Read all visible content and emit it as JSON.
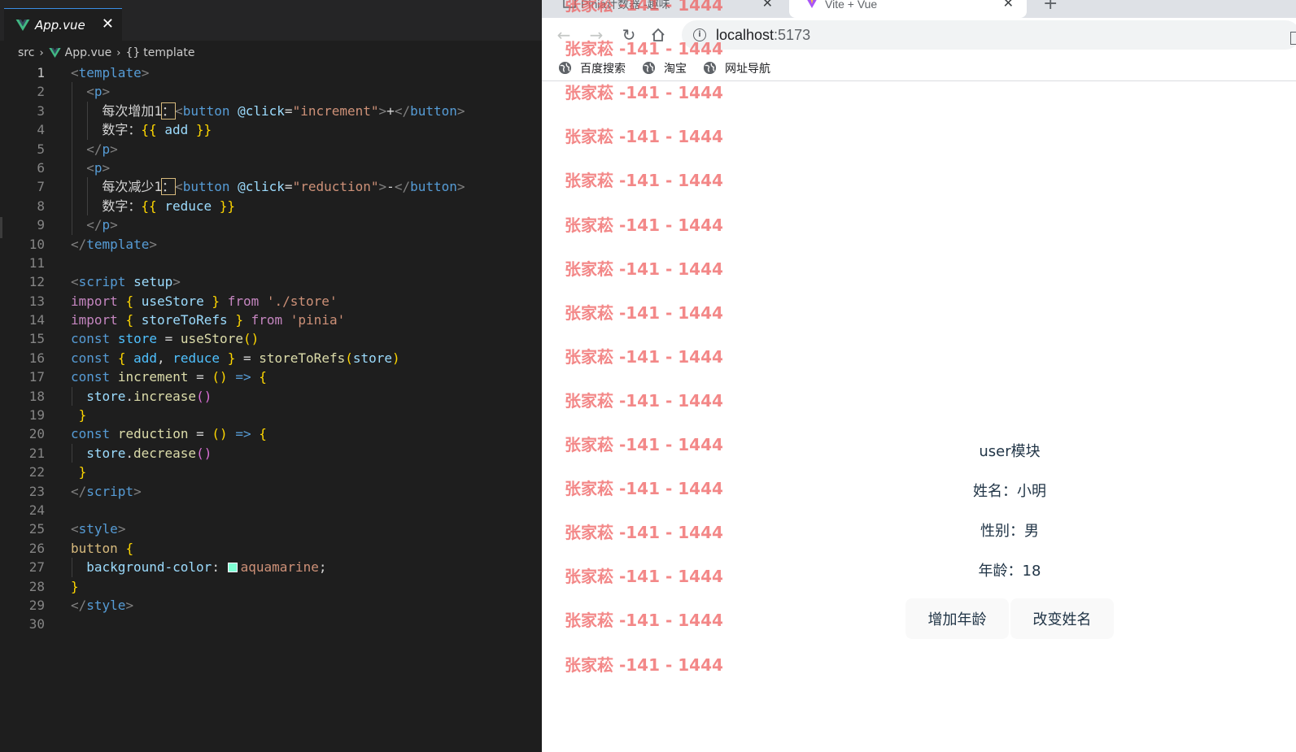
{
  "editor": {
    "tab": {
      "label": "App.vue",
      "close_glyph": "✕"
    },
    "breadcrumb": {
      "folder": "src",
      "file": "App.vue",
      "symbol_icon": "{}",
      "symbol": "template"
    },
    "lines": [
      {
        "n": "1",
        "indent": 0,
        "tokens": [
          [
            "tag",
            "<"
          ],
          [
            "tname",
            "template"
          ],
          [
            "tag",
            ">"
          ]
        ]
      },
      {
        "n": "2",
        "indent": 1,
        "tokens": [
          [
            "tag",
            "<"
          ],
          [
            "tname",
            "p"
          ],
          [
            "tag",
            ">"
          ]
        ]
      },
      {
        "n": "3",
        "indent": 2,
        "tokens": [
          [
            "text",
            "每次增加1"
          ],
          [
            "box",
            "："
          ],
          [
            "tag",
            "<"
          ],
          [
            "tname",
            "button"
          ],
          [
            "text",
            " "
          ],
          [
            "attr",
            "@click"
          ],
          [
            "text",
            "="
          ],
          [
            "str",
            "\"increment\""
          ],
          [
            "tag",
            ">"
          ],
          [
            "text",
            "+"
          ],
          [
            "tag",
            "</"
          ],
          [
            "tname",
            "button"
          ],
          [
            "tag",
            ">"
          ]
        ]
      },
      {
        "n": "4",
        "indent": 2,
        "tokens": [
          [
            "text",
            "数字："
          ],
          [
            "b1",
            "{{"
          ],
          [
            "text",
            " "
          ],
          [
            "ident",
            "add"
          ],
          [
            "text",
            " "
          ],
          [
            "b1",
            "}}"
          ]
        ]
      },
      {
        "n": "5",
        "indent": 1,
        "tokens": [
          [
            "tag",
            "</"
          ],
          [
            "tname",
            "p"
          ],
          [
            "tag",
            ">"
          ]
        ]
      },
      {
        "n": "6",
        "indent": 1,
        "tokens": [
          [
            "tag",
            "<"
          ],
          [
            "tname",
            "p"
          ],
          [
            "tag",
            ">"
          ]
        ]
      },
      {
        "n": "7",
        "indent": 2,
        "tokens": [
          [
            "text",
            "每次减少1"
          ],
          [
            "box",
            "："
          ],
          [
            "tag",
            "<"
          ],
          [
            "tname",
            "button"
          ],
          [
            "text",
            " "
          ],
          [
            "attr",
            "@click"
          ],
          [
            "text",
            "="
          ],
          [
            "str",
            "\"reduction\""
          ],
          [
            "tag",
            ">"
          ],
          [
            "text",
            "-"
          ],
          [
            "tag",
            "</"
          ],
          [
            "tname",
            "button"
          ],
          [
            "tag",
            ">"
          ]
        ]
      },
      {
        "n": "8",
        "indent": 2,
        "tokens": [
          [
            "text",
            "数字："
          ],
          [
            "b1",
            "{{"
          ],
          [
            "text",
            " "
          ],
          [
            "ident",
            "reduce"
          ],
          [
            "text",
            " "
          ],
          [
            "b1",
            "}}"
          ]
        ]
      },
      {
        "n": "9",
        "indent": 1,
        "tokens": [
          [
            "tag",
            "</"
          ],
          [
            "tname",
            "p"
          ],
          [
            "tag",
            ">"
          ]
        ]
      },
      {
        "n": "10",
        "indent": 0,
        "tokens": [
          [
            "tag",
            "</"
          ],
          [
            "tname",
            "template"
          ],
          [
            "tag",
            ">"
          ]
        ]
      },
      {
        "n": "11",
        "indent": 0,
        "tokens": []
      },
      {
        "n": "12",
        "indent": 0,
        "tokens": [
          [
            "tag",
            "<"
          ],
          [
            "tname",
            "script"
          ],
          [
            "text",
            " "
          ],
          [
            "attr",
            "setup"
          ],
          [
            "tag",
            ">"
          ]
        ]
      },
      {
        "n": "13",
        "indent": 0,
        "tokens": [
          [
            "kw",
            "import"
          ],
          [
            "text",
            " "
          ],
          [
            "b1",
            "{"
          ],
          [
            "text",
            " "
          ],
          [
            "ident",
            "useStore"
          ],
          [
            "text",
            " "
          ],
          [
            "b1",
            "}"
          ],
          [
            "text",
            " "
          ],
          [
            "kw",
            "from"
          ],
          [
            "text",
            " "
          ],
          [
            "str",
            "'./store'"
          ]
        ]
      },
      {
        "n": "14",
        "indent": 0,
        "tokens": [
          [
            "kw",
            "import"
          ],
          [
            "text",
            " "
          ],
          [
            "b1",
            "{"
          ],
          [
            "text",
            " "
          ],
          [
            "ident",
            "storeToRefs"
          ],
          [
            "text",
            " "
          ],
          [
            "b1",
            "}"
          ],
          [
            "text",
            " "
          ],
          [
            "kw",
            "from"
          ],
          [
            "text",
            " "
          ],
          [
            "str",
            "'pinia'"
          ]
        ]
      },
      {
        "n": "15",
        "indent": 0,
        "tokens": [
          [
            "const",
            "const"
          ],
          [
            "text",
            " "
          ],
          [
            "var",
            "store"
          ],
          [
            "text",
            " = "
          ],
          [
            "fn",
            "useStore"
          ],
          [
            "b1",
            "()"
          ]
        ]
      },
      {
        "n": "16",
        "indent": 0,
        "tokens": [
          [
            "const",
            "const"
          ],
          [
            "text",
            " "
          ],
          [
            "b1",
            "{"
          ],
          [
            "text",
            " "
          ],
          [
            "var",
            "add"
          ],
          [
            "text",
            ", "
          ],
          [
            "var",
            "reduce"
          ],
          [
            "text",
            " "
          ],
          [
            "b1",
            "}"
          ],
          [
            "text",
            " = "
          ],
          [
            "fn",
            "storeToRefs"
          ],
          [
            "b1",
            "("
          ],
          [
            "ident",
            "store"
          ],
          [
            "b1",
            ")"
          ]
        ]
      },
      {
        "n": "17",
        "indent": 0,
        "tokens": [
          [
            "const",
            "const"
          ],
          [
            "text",
            " "
          ],
          [
            "fn",
            "increment"
          ],
          [
            "text",
            " = "
          ],
          [
            "b1",
            "()"
          ],
          [
            "text",
            " "
          ],
          [
            "const",
            "=>"
          ],
          [
            "text",
            " "
          ],
          [
            "b1",
            "{"
          ]
        ]
      },
      {
        "n": "18",
        "indent": 1,
        "tokens": [
          [
            "ident",
            "store"
          ],
          [
            "text",
            "."
          ],
          [
            "fn",
            "increase"
          ],
          [
            "b2",
            "()"
          ]
        ]
      },
      {
        "n": "19",
        "indent": 0,
        "tokens": [
          [
            "text",
            " "
          ],
          [
            "b1",
            "}"
          ]
        ]
      },
      {
        "n": "20",
        "indent": 0,
        "tokens": [
          [
            "const",
            "const"
          ],
          [
            "text",
            " "
          ],
          [
            "fn",
            "reduction"
          ],
          [
            "text",
            " = "
          ],
          [
            "b1",
            "()"
          ],
          [
            "text",
            " "
          ],
          [
            "const",
            "=>"
          ],
          [
            "text",
            " "
          ],
          [
            "b1",
            "{"
          ]
        ]
      },
      {
        "n": "21",
        "indent": 1,
        "tokens": [
          [
            "ident",
            "store"
          ],
          [
            "text",
            "."
          ],
          [
            "fn",
            "decrease"
          ],
          [
            "b2",
            "()"
          ]
        ]
      },
      {
        "n": "22",
        "indent": 0,
        "tokens": [
          [
            "text",
            " "
          ],
          [
            "b1",
            "}"
          ]
        ]
      },
      {
        "n": "23",
        "indent": 0,
        "tokens": [
          [
            "tag",
            "</"
          ],
          [
            "tname",
            "script"
          ],
          [
            "tag",
            ">"
          ]
        ]
      },
      {
        "n": "24",
        "indent": 0,
        "tokens": []
      },
      {
        "n": "25",
        "indent": 0,
        "tokens": [
          [
            "tag",
            "<"
          ],
          [
            "tname",
            "style"
          ],
          [
            "tag",
            ">"
          ]
        ]
      },
      {
        "n": "26",
        "indent": 0,
        "tokens": [
          [
            "sel",
            "button"
          ],
          [
            "text",
            " "
          ],
          [
            "b1",
            "{"
          ]
        ]
      },
      {
        "n": "27",
        "indent": 1,
        "tokens": [
          [
            "prop",
            "background-color"
          ],
          [
            "text",
            ": "
          ],
          [
            "swatch",
            "#7fffd4"
          ],
          [
            "str",
            "aquamarine"
          ],
          [
            "text",
            ";"
          ]
        ]
      },
      {
        "n": "28",
        "indent": 0,
        "tokens": [
          [
            "b1",
            "}"
          ]
        ]
      },
      {
        "n": "29",
        "indent": 0,
        "tokens": [
          [
            "tag",
            "</"
          ],
          [
            "tname",
            "style"
          ],
          [
            "tag",
            ">"
          ]
        ]
      },
      {
        "n": "30",
        "indent": 0,
        "tokens": []
      }
    ],
    "current_line": "1"
  },
  "browser": {
    "tabs": [
      {
        "title": "Pinia计数器 -趣味",
        "active": false
      },
      {
        "title": "Vite + Vue",
        "active": true
      }
    ],
    "new_tab_glyph": "+",
    "address": {
      "host": "localhost",
      "port": ":5173"
    },
    "bookmarks": [
      "百度搜索",
      "淘宝",
      "网址导航"
    ],
    "watermark_text": "张家菘 -141 - 1444",
    "watermark_count": 16,
    "app": {
      "title": "user模块",
      "name_line": "姓名：小明",
      "gender_line": "性别：男",
      "age_line": "年龄：18",
      "buttons": {
        "increase_age": "增加年龄",
        "change_name": "改变姓名"
      }
    }
  },
  "colors": {
    "editor_bg": "#1e1e1e",
    "watermark": "#ee5a5a",
    "swatch_aquamarine": "#7fffd4",
    "vue_green": "#41b883"
  }
}
